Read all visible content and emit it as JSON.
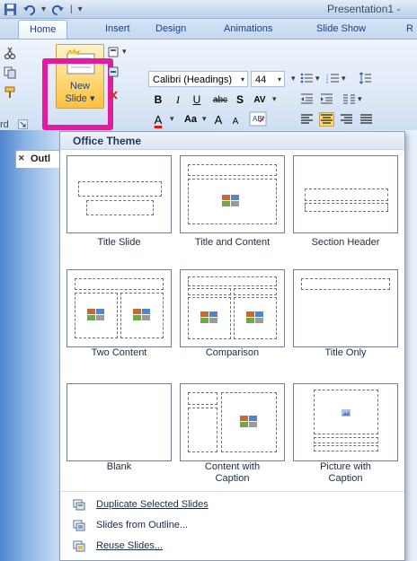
{
  "window": {
    "title": "Presentation1 -"
  },
  "quick_access": {
    "icons": [
      "save-icon",
      "undo-icon",
      "redo-icon",
      "customize-arrow-icon"
    ],
    "separator": "|"
  },
  "ribbon_tabs": [
    {
      "label": "Home",
      "active": true
    },
    {
      "label": "Insert"
    },
    {
      "label": "Design"
    },
    {
      "label": "Animations"
    },
    {
      "label": "Slide Show"
    },
    {
      "label": "R"
    }
  ],
  "ribbon": {
    "new_slide_label_top": "New",
    "new_slide_label_bottom": "Slide",
    "new_slide_arrow": "▾",
    "font_name": "Calibri (Headings)",
    "font_size": "44",
    "dropdown_arrow": "▾",
    "bold": "B",
    "italic": "I",
    "underline": "U",
    "strike": "abc",
    "shadow": "S",
    "char_spacing": "AV",
    "font_color": "A",
    "change_case": "Aa",
    "grow_font": "A",
    "shrink_font": "A",
    "clipboard_label": "rd",
    "accent_color": "#e31b9f"
  },
  "left_panel": {
    "outline_tab": "Outl"
  },
  "gallery": {
    "header": "Office Theme",
    "layouts": [
      {
        "label": "Title Slide",
        "label2": ""
      },
      {
        "label": "Title and Content",
        "label2": ""
      },
      {
        "label": "Section Header",
        "label2": ""
      },
      {
        "label": "Two Content",
        "label2": ""
      },
      {
        "label": "Comparison",
        "label2": ""
      },
      {
        "label": "Title Only",
        "label2": ""
      },
      {
        "label": "Blank",
        "label2": ""
      },
      {
        "label": "Content with",
        "label2": "Caption"
      },
      {
        "label": "Picture with",
        "label2": "Caption"
      }
    ]
  },
  "menu_items": [
    {
      "label": "Duplicate Selected Slides",
      "icon": "duplicate-slides-icon"
    },
    {
      "label": "Slides from Outline...",
      "icon": "slides-from-outline-icon"
    },
    {
      "label": "Reuse Slides...",
      "icon": "reuse-slides-icon"
    }
  ]
}
